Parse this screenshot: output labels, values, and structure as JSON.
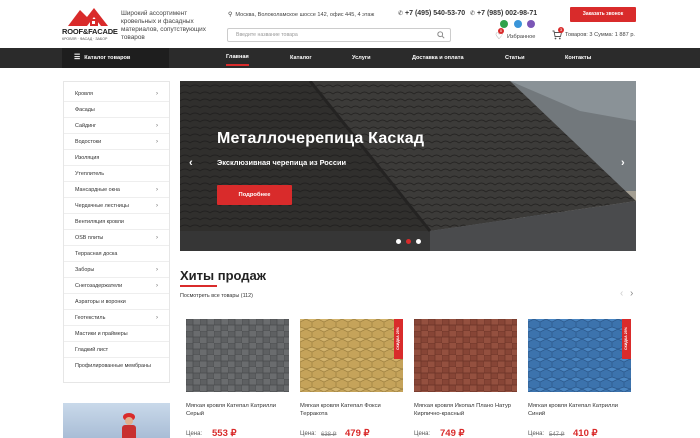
{
  "header": {
    "logo_text": "ROOF&FACADE",
    "logo_sub": "КРОВЛЯ · ФАСАД · ЗАБОР",
    "tagline": "Широкий ассортимент кровельных и фасадных материалов, сопутствующих товаров",
    "address": "Москва, Волоколамское шоссе 142, офис 445, 4 этаж",
    "phone1": "+7 (495) 540-53-70",
    "phone2": "+7 (985) 002-98-71",
    "callback_label": "Заказать звонок",
    "search_placeholder": "Введите название товара",
    "favorites_label": "Избранное",
    "favorites_count": "0",
    "cart_count": "3",
    "cart_text": "Товаров: 3 Сумма: 1 887 р."
  },
  "nav": {
    "catalog_label": "Каталог товаров",
    "items": [
      "Главная",
      "Каталог",
      "Услуги",
      "Доставка и оплата",
      "Статьи",
      "Контакты"
    ]
  },
  "sidebar": {
    "items": [
      {
        "label": "Кровля",
        "arrow": true
      },
      {
        "label": "Фасады",
        "arrow": false
      },
      {
        "label": "Сайдинг",
        "arrow": true
      },
      {
        "label": "Водостоки",
        "arrow": true
      },
      {
        "label": "Изоляция",
        "arrow": false
      },
      {
        "label": "Утеплитель",
        "arrow": false
      },
      {
        "label": "Мансардные окна",
        "arrow": true
      },
      {
        "label": "Чердачные лестницы",
        "arrow": true
      },
      {
        "label": "Вентиляция кровли",
        "arrow": false
      },
      {
        "label": "OSB плиты",
        "arrow": true
      },
      {
        "label": "Террасная доска",
        "arrow": false
      },
      {
        "label": "Заборы",
        "arrow": true
      },
      {
        "label": "Снегозадержатели",
        "arrow": true
      },
      {
        "label": "Аэраторы и воронки",
        "arrow": false
      },
      {
        "label": "Геотекстиль",
        "arrow": true
      },
      {
        "label": "Мастики и праймеры",
        "arrow": false
      },
      {
        "label": "Гладкий лист",
        "arrow": false
      },
      {
        "label": "Профилированные мембраны",
        "arrow": false
      }
    ]
  },
  "slider": {
    "title": "Металлочерепица Каскад",
    "subtitle": "Эксклюзивная черепица из России",
    "button_label": "Подробнее",
    "active_slide": 2,
    "slide_count": 3
  },
  "hits": {
    "title": "Хиты продаж",
    "view_all": "Посмотреть все товары (112)",
    "price_label": "Цена:",
    "products": [
      {
        "name": "Мягкая кровля Катепал Катрилли Серый",
        "price": "553 ₽",
        "old_price": "",
        "badge": "",
        "color": "#5f6163"
      },
      {
        "name": "Мягкая кровля Катепал Фокси Терракота",
        "price": "479 ₽",
        "old_price": "638 ₽",
        "badge": "СКИДКА 25%",
        "color": "#c9a85a"
      },
      {
        "name": "Мягкая кровля Икопал Плано Натур Кирпично-красный",
        "price": "749 ₽",
        "old_price": "",
        "badge": "",
        "color": "#8e4535"
      },
      {
        "name": "Мягкая кровля Катепал Катрилли Синий",
        "price": "410 ₽",
        "old_price": "547 ₽",
        "badge": "СКИДКА 25%",
        "color": "#3f78b4"
      }
    ]
  },
  "colors": {
    "accent": "#d92b2b",
    "navbar": "#2b2b2b"
  }
}
